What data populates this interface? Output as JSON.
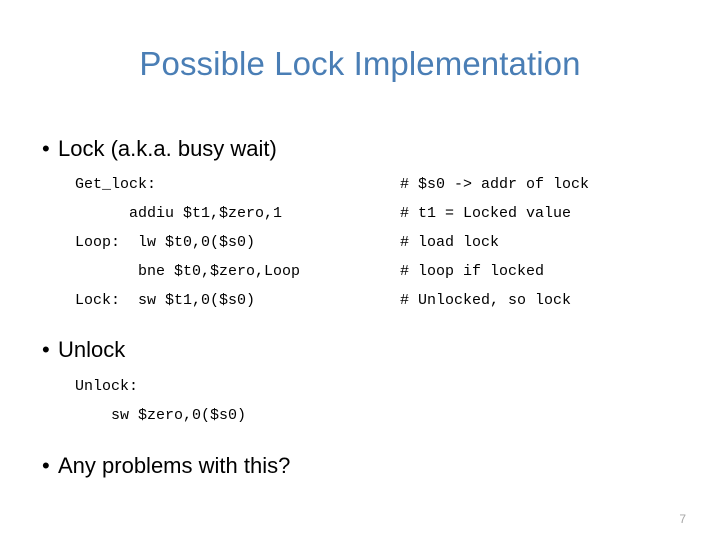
{
  "slide": {
    "title": "Possible Lock Implementation",
    "title_color": "#4A7EB5",
    "background_color": "#FFFFFF",
    "page_number": "7"
  },
  "bullets": {
    "lock": "Lock (a.k.a. busy wait)",
    "unlock": "Unlock",
    "any_problems": "Any problems with this?",
    "marker": "•"
  },
  "get_lock_code": {
    "lines": [
      {
        "code": "Get_lock:",
        "comment": "# $s0 -> addr of lock"
      },
      {
        "code": "      addiu $t1,$zero,1",
        "comment": "# t1 = Locked value"
      },
      {
        "code": "Loop:  lw $t0,0($s0)",
        "comment": "# load lock"
      },
      {
        "code": "       bne $t0,$zero,Loop",
        "comment": "# loop if locked"
      },
      {
        "code": "Lock:  sw $t1,0($s0)",
        "comment": "# Unlocked, so lock"
      }
    ]
  },
  "unlock_code": {
    "lines": [
      {
        "code": "Unlock:",
        "comment": ""
      },
      {
        "code": "    sw $zero,0($s0)",
        "comment": ""
      }
    ]
  }
}
